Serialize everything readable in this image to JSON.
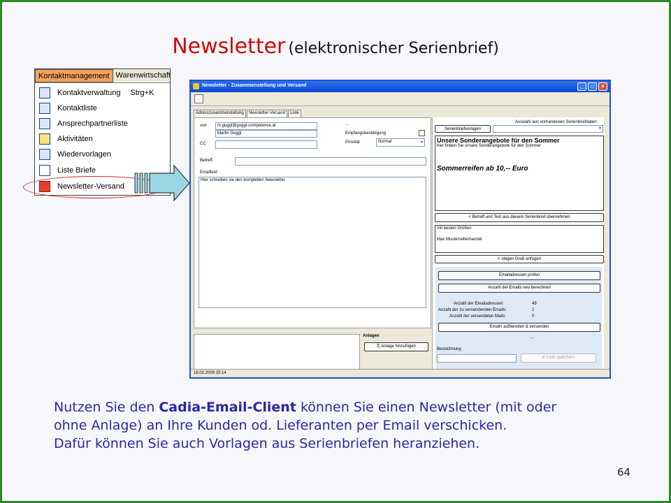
{
  "slide": {
    "title_main": "Newsletter",
    "title_sub": "(elektronischer Serienbrief)",
    "page_number": "64",
    "body": {
      "line1_a": "Nutzen Sie den",
      "line1_bold": "Cadia-Email-Client",
      "line1_b": "können Sie einen Newsletter (mit oder",
      "line2": "ohne Anlage) an Ihre Kunden od. Lieferanten per Email verschicken.",
      "line3": "Dafür können Sie auch Vorlagen aus Serienbriefen heranziehen."
    }
  },
  "menu": {
    "tabs": [
      "Kontaktmanagement",
      "Warenwirtschaft"
    ],
    "items": [
      {
        "label": "Kontaktverwaltung",
        "shortcut": "Strg+K"
      },
      {
        "label": "Kontaktliste"
      },
      {
        "label": "Ansprechpartnerliste"
      },
      {
        "label": "Aktivitäten"
      },
      {
        "label": "Wiedervorlagen"
      },
      {
        "label": "Liste Briefe"
      },
      {
        "label": "Newsletter-Versand"
      }
    ]
  },
  "window": {
    "title": "Newsletter - Zusammenstellung und Versand",
    "tabs": [
      "Adresszusammenstellung",
      "Newsletter-Versand",
      "Liste"
    ],
    "left": {
      "von_label": "von",
      "von_email": "m.guggi@guggi-competence.at",
      "von_name": "Martin Guggi",
      "cc_label": "CC",
      "dots": "...",
      "empfang_label": "Empfangsbestätigung",
      "prioritaet_label": "Priorität",
      "prioritaet_value": "Normal",
      "betreff_label": "Betreff:",
      "emailtext_label": "Emailtext:",
      "emailtext_value": "Hier schreiben sie den kompletten Newsletter"
    },
    "right": {
      "vorlagen_button": "Serienbriefvorlagen",
      "auswahl_label": "Auswahl aus vorhandenen Serienbriefdaten:",
      "brief_title": "Unsere Sonderangebote für den Sommer",
      "brief_line": "hier finden Sie unsere Sonderangebote für den Sommer",
      "brief_highlight": "Sommerreifen ab 10,-- Euro",
      "uebernehmen_button": "< Betreff und Text aus diesem Serienbrief übernehmen",
      "gruss_line1": "mit besten Grüßen",
      "gruss_line2": "Max Musterreifenhandel",
      "gruss_button": "< obigen Gruß anfügen",
      "pruefen_button": "Emailadressen prüfen",
      "berechnen_button": "Anzahl der Emails neu berechnen",
      "stats": [
        {
          "label": "Anzahl der Emailadressen:",
          "value": "49"
        },
        {
          "label": "Anzahl der zu versendenden Emails:",
          "value": "2"
        },
        {
          "label": "Anzahl der versendeten Mails:",
          "value": "0"
        }
      ],
      "versenden_button": "Emails aufbereiten & versenden",
      "dots": "...",
      "bezeichnung_label": "Bezeichnung",
      "liste_button": "in Liste speichern"
    },
    "anlagen_label": "Anlagen",
    "anlage_button": "Anlage hinzufügen",
    "status": "18.02.2009 15:14"
  },
  "colors": {
    "title_red": "#cc0a0a",
    "body_blue": "#2a27a4",
    "slide_border": "#2a8a2a",
    "menu_highlight": "#f5a25e",
    "ring_red": "#d4202b"
  }
}
